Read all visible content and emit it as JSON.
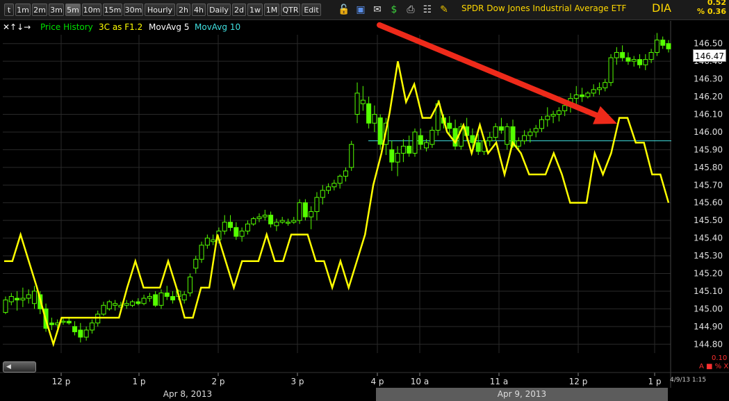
{
  "toolbar": {
    "buttons": [
      "t",
      "1m",
      "2m",
      "3m",
      "5m",
      "10m",
      "15m",
      "30m",
      "Hourly",
      "2h",
      "4h",
      "Daily",
      "2d",
      "1w",
      "1M",
      "QTR",
      "Edit"
    ],
    "active": "5m",
    "icons": [
      "lock-icon",
      "save-icon",
      "email-icon",
      "dollar-icon",
      "print-icon",
      "edit-icon",
      "pencil-icon"
    ]
  },
  "header": {
    "symbol_name": "SPDR Dow Jones Industrial Average ETF",
    "symbol": "DIA",
    "change": "0.52",
    "change_pct": "% 0.36"
  },
  "legend": {
    "items": [
      {
        "label": "Price History",
        "color": "#00e000"
      },
      {
        "label": "3C as F1.2",
        "color": "#ffff00"
      },
      {
        "label": "MovAvg 5",
        "color": "#ffffff"
      },
      {
        "label": "MovAvg 10",
        "color": "#40e0e0"
      }
    ]
  },
  "price_box": "146.47",
  "indicator": {
    "value": "0.10",
    "controls": "A ■ % X"
  },
  "datetime": "4/9/13 1:15",
  "date_bar": [
    "Apr 8, 2013",
    "Apr 9, 2013"
  ],
  "colors": {
    "candle": "#55ff00",
    "three_c": "#ffff00",
    "ma_line": "#40e0e0",
    "arrow": "#ee2a1a",
    "grid": "#2a2a2a"
  },
  "chart_data": {
    "type": "line",
    "title": "SPDR Dow Jones Industrial Average ETF",
    "ylim": [
      144.8,
      146.5
    ],
    "y_ticks": [
      "146.50",
      "146.40",
      "146.30",
      "146.20",
      "146.10",
      "146.00",
      "145.90",
      "145.80",
      "145.70",
      "145.60",
      "145.50",
      "145.40",
      "145.30",
      "145.20",
      "145.10",
      "145.00",
      "144.90",
      "144.80"
    ],
    "x_ticks": [
      "12 p",
      "1 p",
      "2 p",
      "3 p",
      "4 p",
      "10 a",
      "11 a",
      "12 p",
      "1 p"
    ],
    "grid": true,
    "series": [
      {
        "name": "Price History",
        "style": "candlestick",
        "ohlc": [
          [
            144.98,
            145.07,
            144.97,
            145.05
          ],
          [
            145.04,
            145.09,
            145.02,
            145.07
          ],
          [
            145.06,
            145.1,
            144.99,
            145.05
          ],
          [
            145.05,
            145.12,
            145.01,
            145.06
          ],
          [
            145.06,
            145.11,
            145.03,
            145.08
          ],
          [
            145.03,
            145.13,
            145.0,
            145.1
          ],
          [
            145.08,
            145.1,
            144.97,
            145.0
          ],
          [
            145.0,
            145.03,
            144.87,
            144.89
          ],
          [
            144.92,
            144.95,
            144.88,
            144.91
          ],
          [
            144.91,
            144.94,
            144.89,
            144.92
          ],
          [
            144.93,
            144.95,
            144.91,
            144.93
          ],
          [
            144.93,
            144.95,
            144.91,
            144.92
          ],
          [
            144.9,
            144.93,
            144.85,
            144.87
          ],
          [
            144.88,
            144.92,
            144.81,
            144.84
          ],
          [
            144.84,
            144.9,
            144.82,
            144.88
          ],
          [
            144.88,
            144.94,
            144.86,
            144.92
          ],
          [
            144.92,
            144.99,
            144.9,
            144.97
          ],
          [
            144.97,
            145.04,
            144.96,
            145.02
          ],
          [
            145.0,
            145.05,
            144.99,
            145.04
          ],
          [
            145.02,
            145.05,
            144.99,
            145.03
          ],
          [
            145.01,
            145.04,
            144.99,
            145.02
          ],
          [
            145.02,
            145.05,
            145.0,
            145.03
          ],
          [
            145.02,
            145.05,
            145.01,
            145.04
          ],
          [
            145.04,
            145.06,
            145.02,
            145.03
          ],
          [
            145.03,
            145.08,
            145.02,
            145.06
          ],
          [
            145.06,
            145.09,
            145.04,
            145.07
          ],
          [
            145.08,
            145.1,
            145.01,
            145.02
          ],
          [
            145.02,
            145.11,
            145.0,
            145.09
          ],
          [
            145.09,
            145.13,
            145.05,
            145.07
          ],
          [
            145.07,
            145.1,
            145.03,
            145.05
          ],
          [
            145.07,
            145.11,
            145.05,
            145.1
          ],
          [
            145.05,
            145.1,
            145.03,
            145.08
          ],
          [
            145.09,
            145.2,
            145.07,
            145.18
          ],
          [
            145.23,
            145.3,
            145.2,
            145.28
          ],
          [
            145.28,
            145.38,
            145.26,
            145.36
          ],
          [
            145.36,
            145.42,
            145.34,
            145.4
          ],
          [
            145.38,
            145.42,
            145.36,
            145.39
          ],
          [
            145.39,
            145.46,
            145.37,
            145.44
          ],
          [
            145.44,
            145.53,
            145.42,
            145.49
          ],
          [
            145.49,
            145.53,
            145.44,
            145.46
          ],
          [
            145.46,
            145.49,
            145.39,
            145.41
          ],
          [
            145.41,
            145.46,
            145.38,
            145.44
          ],
          [
            145.44,
            145.5,
            145.42,
            145.48
          ],
          [
            145.48,
            145.52,
            145.47,
            145.51
          ],
          [
            145.51,
            145.54,
            145.49,
            145.52
          ],
          [
            145.52,
            145.56,
            145.5,
            145.53
          ],
          [
            145.53,
            145.55,
            145.46,
            145.48
          ],
          [
            145.47,
            145.51,
            145.44,
            145.49
          ],
          [
            145.49,
            145.52,
            145.48,
            145.5
          ],
          [
            145.49,
            145.51,
            145.47,
            145.49
          ],
          [
            145.49,
            145.52,
            145.48,
            145.5
          ],
          [
            145.5,
            145.62,
            145.48,
            145.6
          ],
          [
            145.6,
            145.62,
            145.5,
            145.52
          ],
          [
            145.52,
            145.58,
            145.45,
            145.55
          ],
          [
            145.55,
            145.66,
            145.5,
            145.63
          ],
          [
            145.63,
            145.7,
            145.59,
            145.67
          ],
          [
            145.67,
            145.71,
            145.65,
            145.69
          ],
          [
            145.69,
            145.73,
            145.67,
            145.71
          ],
          [
            145.71,
            145.76,
            145.68,
            145.75
          ],
          [
            145.75,
            145.8,
            145.72,
            145.78
          ],
          [
            145.8,
            145.95,
            145.78,
            145.93
          ],
          [
            146.1,
            146.28,
            146.05,
            146.22
          ],
          [
            146.16,
            146.26,
            146.12,
            146.18
          ],
          [
            146.16,
            146.2,
            146.02,
            146.05
          ],
          [
            146.05,
            146.15,
            146.0,
            146.1
          ],
          [
            146.08,
            146.1,
            145.9,
            145.93
          ],
          [
            145.93,
            146.08,
            145.87,
            146.05
          ],
          [
            145.9,
            145.95,
            145.78,
            145.83
          ],
          [
            145.83,
            145.92,
            145.75,
            145.88
          ],
          [
            145.88,
            145.96,
            145.83,
            145.92
          ],
          [
            145.92,
            145.98,
            145.86,
            145.88
          ],
          [
            145.88,
            146.02,
            145.86,
            146.0
          ],
          [
            145.98,
            146.02,
            145.9,
            145.93
          ],
          [
            145.91,
            145.96,
            145.89,
            145.94
          ],
          [
            145.93,
            146.03,
            145.91,
            146.01
          ],
          [
            146.01,
            146.18,
            145.98,
            146.16
          ],
          [
            146.08,
            146.1,
            146.02,
            146.05
          ],
          [
            146.05,
            146.09,
            145.98,
            146.02
          ],
          [
            146.02,
            146.07,
            145.9,
            145.92
          ],
          [
            145.92,
            146.05,
            145.9,
            146.03
          ],
          [
            146.03,
            146.08,
            145.95,
            145.98
          ],
          [
            145.98,
            146.02,
            145.9,
            145.94
          ],
          [
            145.94,
            145.99,
            145.87,
            145.89
          ],
          [
            145.89,
            145.97,
            145.87,
            145.95
          ],
          [
            145.95,
            146.0,
            145.92,
            145.97
          ],
          [
            145.97,
            146.05,
            145.95,
            146.03
          ],
          [
            146.03,
            146.08,
            145.99,
            146.01
          ],
          [
            145.93,
            146.05,
            145.9,
            146.03
          ],
          [
            146.03,
            146.07,
            145.91,
            145.92
          ],
          [
            145.92,
            145.97,
            145.9,
            145.95
          ],
          [
            145.95,
            146.01,
            145.93,
            145.98
          ],
          [
            145.98,
            146.02,
            145.94,
            146.0
          ],
          [
            146.0,
            146.04,
            145.97,
            146.02
          ],
          [
            146.02,
            146.09,
            146.0,
            146.07
          ],
          [
            146.07,
            146.14,
            146.03,
            146.09
          ],
          [
            146.09,
            146.12,
            146.05,
            146.1
          ],
          [
            146.1,
            146.14,
            146.06,
            146.12
          ],
          [
            146.12,
            146.18,
            146.09,
            146.15
          ],
          [
            146.15,
            146.22,
            146.11,
            146.19
          ],
          [
            146.19,
            146.26,
            146.15,
            146.21
          ],
          [
            146.21,
            146.25,
            146.17,
            146.2
          ],
          [
            146.2,
            146.23,
            146.19,
            146.22
          ],
          [
            146.22,
            146.27,
            146.2,
            146.24
          ],
          [
            146.24,
            146.28,
            146.21,
            146.25
          ],
          [
            146.25,
            146.3,
            146.23,
            146.28
          ],
          [
            146.28,
            146.44,
            146.26,
            146.42
          ],
          [
            146.42,
            146.48,
            146.38,
            146.45
          ],
          [
            146.45,
            146.49,
            146.4,
            146.42
          ],
          [
            146.42,
            146.45,
            146.38,
            146.4
          ],
          [
            146.4,
            146.43,
            146.37,
            146.41
          ],
          [
            146.41,
            146.44,
            146.36,
            146.38
          ],
          [
            146.38,
            146.44,
            146.35,
            146.41
          ],
          [
            146.41,
            146.47,
            146.39,
            146.45
          ],
          [
            146.45,
            146.56,
            146.43,
            146.52
          ],
          [
            146.52,
            146.54,
            146.47,
            146.49
          ],
          [
            146.5,
            146.52,
            146.45,
            146.47
          ]
        ]
      },
      {
        "name": "3C as F1.2",
        "style": "line",
        "values": [
          145.27,
          145.27,
          145.42,
          145.27,
          145.12,
          144.95,
          144.8,
          144.95,
          144.95,
          144.95,
          144.95,
          144.95,
          144.95,
          144.95,
          144.95,
          145.12,
          145.27,
          145.12,
          145.12,
          145.12,
          145.27,
          145.12,
          144.95,
          144.95,
          145.12,
          145.12,
          145.42,
          145.27,
          145.12,
          145.27,
          145.27,
          145.27,
          145.42,
          145.27,
          145.27,
          145.42,
          145.42,
          145.42,
          145.27,
          145.27,
          145.12,
          145.27,
          145.12,
          145.27,
          145.42,
          145.7,
          145.88,
          146.11,
          146.4,
          146.17,
          146.27,
          146.08,
          146.08,
          146.17,
          146.0,
          145.94,
          146.04,
          145.88,
          146.04,
          145.88,
          145.94,
          145.76,
          145.94,
          145.88,
          145.76,
          145.76,
          145.76,
          145.88,
          145.76,
          145.6,
          145.6,
          145.6,
          145.88,
          145.76,
          145.88,
          146.08,
          146.08,
          145.94,
          145.94,
          145.76,
          145.76,
          145.6
        ]
      },
      {
        "name": "MovAvg 10",
        "style": "line",
        "values": [
          145.95,
          145.95
        ]
      }
    ]
  }
}
